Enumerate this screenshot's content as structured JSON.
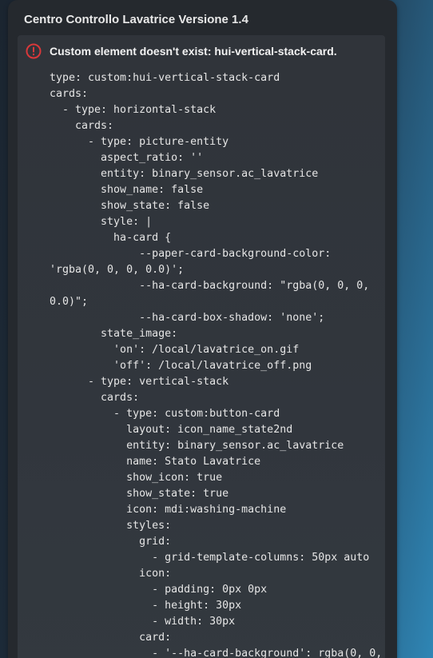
{
  "card": {
    "title": "Centro Controllo Lavatrice Versione 1.4"
  },
  "error": {
    "icon": "error-circle-icon",
    "icon_color": "#d9383a",
    "message": "Custom element doesn't exist: hui-vertical-stack-card."
  },
  "code_lines": [
    "type: custom:hui-vertical-stack-card",
    "cards:",
    "  - type: horizontal-stack",
    "    cards:",
    "      - type: picture-entity",
    "        aspect_ratio: ''",
    "        entity: binary_sensor.ac_lavatrice",
    "        show_name: false",
    "        show_state: false",
    "        style: |",
    "          ha-card {",
    "              --paper-card-background-color:",
    "'rgba(0, 0, 0, 0.0)';",
    "              --ha-card-background: \"rgba(0, 0, 0,",
    "0.0)\";",
    "              --ha-card-box-shadow: 'none';",
    "        state_image:",
    "          'on': /local/lavatrice_on.gif",
    "          'off': /local/lavatrice_off.png",
    "      - type: vertical-stack",
    "        cards:",
    "          - type: custom:button-card",
    "            layout: icon_name_state2nd",
    "            entity: binary_sensor.ac_lavatrice",
    "            name: Stato Lavatrice",
    "            show_icon: true",
    "            show_state: true",
    "            icon: mdi:washing-machine",
    "            styles:",
    "              grid:",
    "                - grid-template-columns: 50px auto",
    "              icon:",
    "                - padding: 0px 0px",
    "                - height: 30px",
    "                - width: 30px",
    "              card:",
    "                - '--ha-card-background': rgba(0, 0,"
  ]
}
